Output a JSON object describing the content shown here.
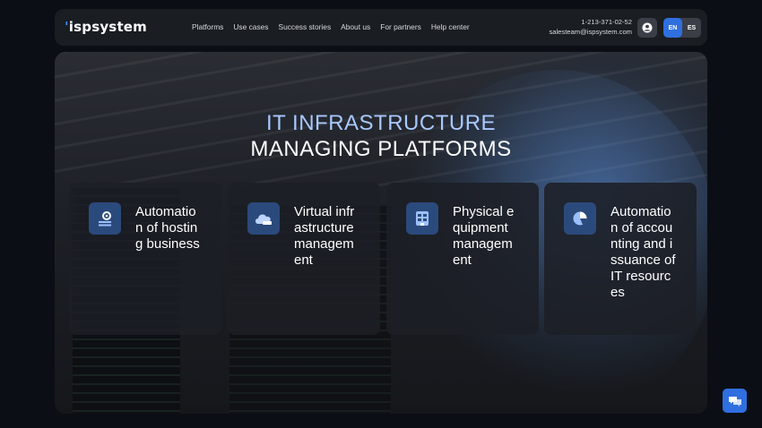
{
  "header": {
    "logo": "ispsystem",
    "nav": [
      "Platforms",
      "Use cases",
      "Success stories",
      "About us",
      "For partners",
      "Help center"
    ],
    "phone": "1-213-371-02-52",
    "email": "salesteam@ispsystem.com",
    "languages": [
      "EN",
      "ES"
    ],
    "active_language": "EN"
  },
  "hero": {
    "title_line1": "IT INFRASTRUCTURE",
    "title_line2": "MANAGING PLATFORMS",
    "cards": [
      {
        "label": "Automation of hosting business",
        "icon": "hosting-gear-icon"
      },
      {
        "label": "Virtual infrastructure management",
        "icon": "cloud-icon"
      },
      {
        "label": "Physical equipment management",
        "icon": "server-icon"
      },
      {
        "label": "Automation of accounting and issuance of IT resources",
        "icon": "pie-chart-icon"
      }
    ]
  },
  "colors": {
    "accent": "#2f6fe0",
    "title_highlight": "#a9c8ff",
    "header_bg": "#1a1d22",
    "page_bg": "#0b0e14"
  }
}
